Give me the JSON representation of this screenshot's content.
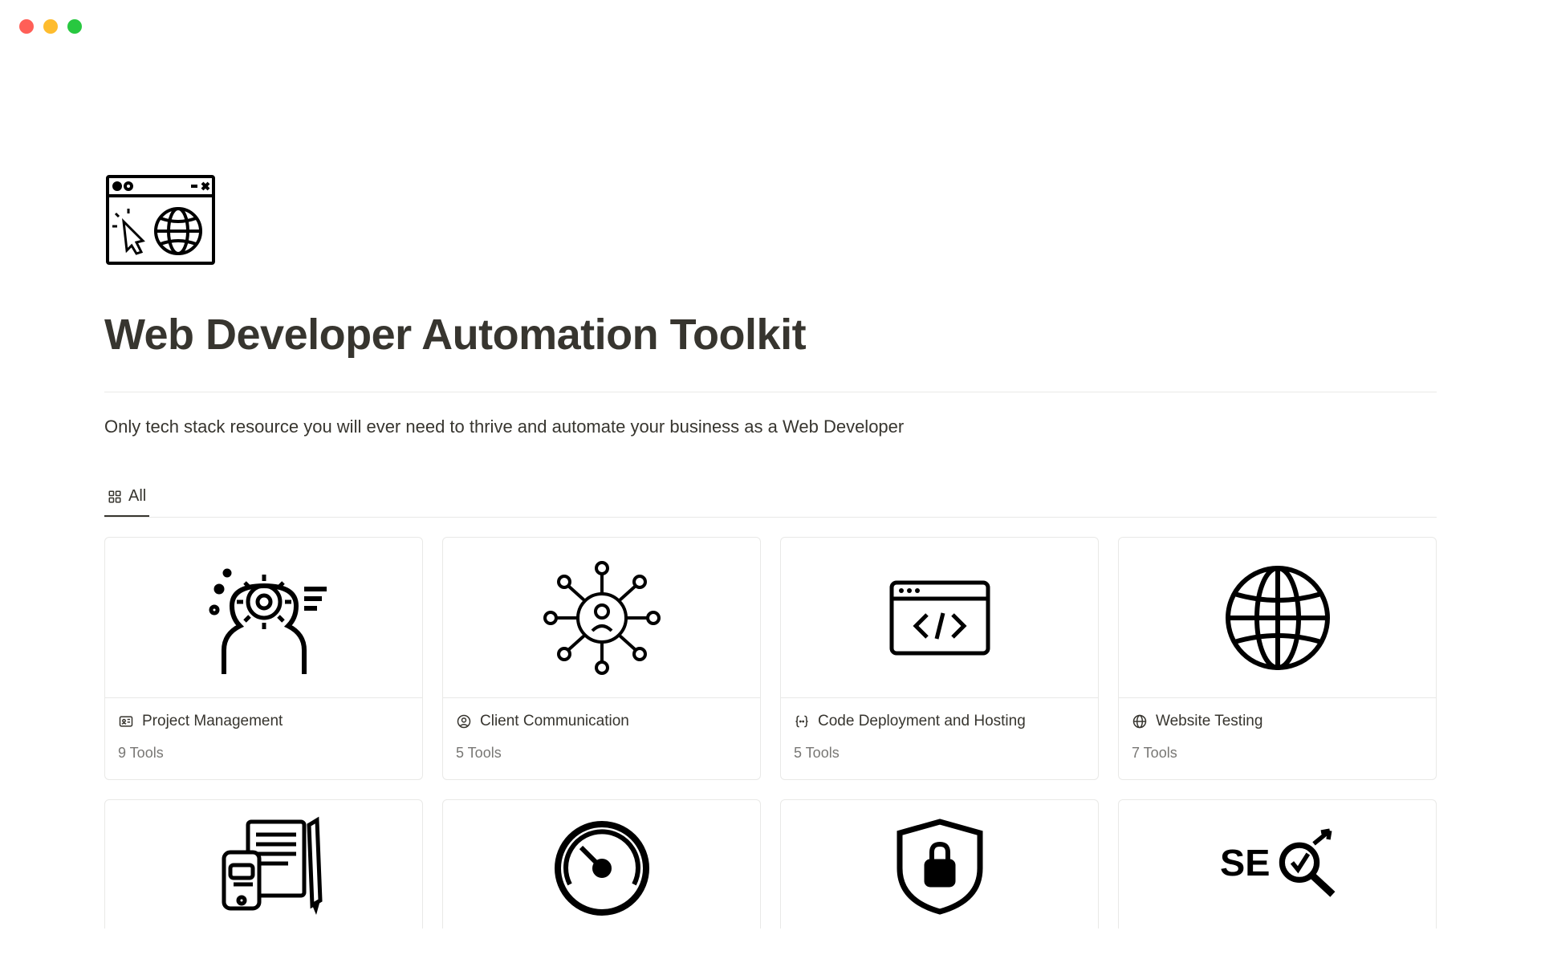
{
  "page": {
    "title": "Web Developer Automation Toolkit",
    "subtitle": "Only tech stack resource you will ever need to thrive and automate your business as a Web Developer"
  },
  "tabs": {
    "all": "All"
  },
  "cards": [
    {
      "title": "Project Management",
      "count": "9 Tools"
    },
    {
      "title": "Client Communication",
      "count": "5 Tools"
    },
    {
      "title": "Code Deployment and Hosting",
      "count": "5 Tools"
    },
    {
      "title": "Website Testing",
      "count": "7 Tools"
    }
  ]
}
